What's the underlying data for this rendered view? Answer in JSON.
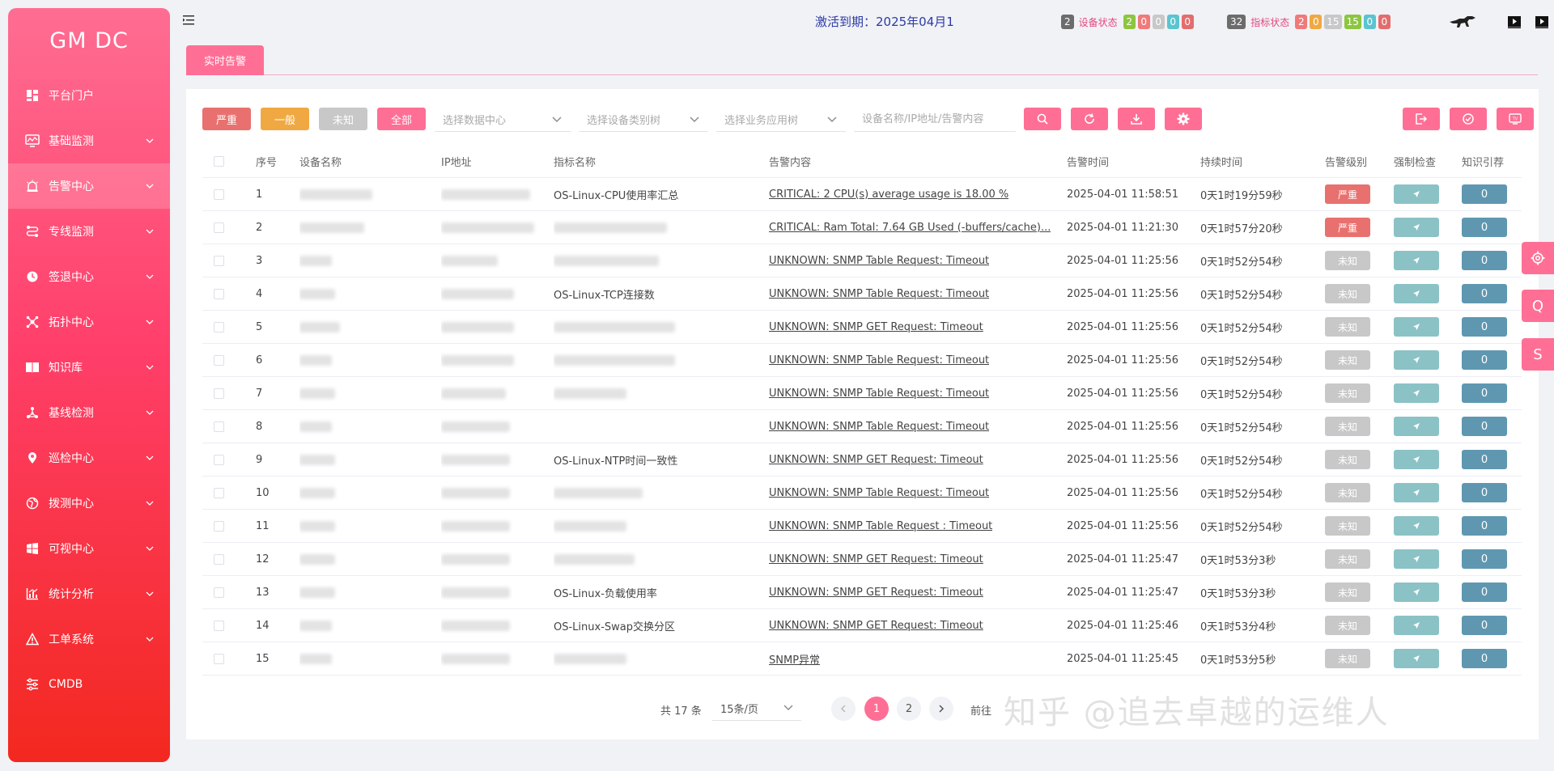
{
  "sidebar": {
    "brand": "GM DC",
    "items": [
      {
        "label": "平台门户",
        "icon": "dashboard-icon",
        "has_children": false,
        "active": false
      },
      {
        "label": "基础监测",
        "icon": "monitor-icon",
        "has_children": true,
        "active": false
      },
      {
        "label": "告警中心",
        "icon": "alarm-icon",
        "has_children": true,
        "active": true
      },
      {
        "label": "专线监测",
        "icon": "route-icon",
        "has_children": true,
        "active": false
      },
      {
        "label": "签退中心",
        "icon": "clock-icon",
        "has_children": true,
        "active": false
      },
      {
        "label": "拓扑中心",
        "icon": "topology-icon",
        "has_children": true,
        "active": false
      },
      {
        "label": "知识库",
        "icon": "book-icon",
        "has_children": true,
        "active": false
      },
      {
        "label": "基线检测",
        "icon": "network-icon",
        "has_children": true,
        "active": false
      },
      {
        "label": "巡检中心",
        "icon": "location-pin-icon",
        "has_children": true,
        "active": false
      },
      {
        "label": "拨测中心",
        "icon": "globe-icon",
        "has_children": true,
        "active": false
      },
      {
        "label": "可视中心",
        "icon": "windows-icon",
        "has_children": true,
        "active": false
      },
      {
        "label": "统计分析",
        "icon": "bar-chart-icon",
        "has_children": true,
        "active": false
      },
      {
        "label": "工单系统",
        "icon": "warning-icon",
        "has_children": true,
        "active": false
      },
      {
        "label": "CMDB",
        "icon": "sliders-icon",
        "has_children": false,
        "active": false
      }
    ]
  },
  "header": {
    "expire_text": "激活到期：2025年04月1",
    "device_status": {
      "count": "2",
      "title": "设备状态",
      "pills": [
        {
          "v": "2",
          "c": "#8cc63f"
        },
        {
          "v": "0",
          "c": "#f07a7a"
        },
        {
          "v": "0",
          "c": "#c8c8c8"
        },
        {
          "v": "0",
          "c": "#5bc4d0"
        },
        {
          "v": "0",
          "c": "#e36d6d"
        }
      ]
    },
    "metric_status": {
      "count": "32",
      "title": "指标状态",
      "pills": [
        {
          "v": "2",
          "c": "#f07a7a"
        },
        {
          "v": "0",
          "c": "#f0a942"
        },
        {
          "v": "15",
          "c": "#c8c8c8"
        },
        {
          "v": "15",
          "c": "#8cc63f"
        },
        {
          "v": "0",
          "c": "#5bc4d0"
        },
        {
          "v": "0",
          "c": "#e36d6d"
        }
      ]
    }
  },
  "tabs": [
    {
      "label": "实时告警"
    }
  ],
  "toolbar": {
    "btn_critical": "严重",
    "btn_normal": "一般",
    "btn_unknown": "未知",
    "btn_all": "全部",
    "select_dc": "选择数据中心",
    "select_device_type": "选择设备类别树",
    "select_app": "选择业务应用树",
    "search_placeholder": "设备名称/IP地址/告警内容"
  },
  "table": {
    "headers": [
      "序号",
      "设备名称",
      "IP地址",
      "指标名称",
      "告警内容",
      "告警时间",
      "持续时间",
      "告警级别",
      "强制检查",
      "知识引荐"
    ],
    "rows": [
      {
        "no": "1",
        "device": "",
        "ip": "",
        "metric": "OS-Linux-CPU使用率汇总",
        "content": "CRITICAL: 2 CPU(s) average usage is 18.00 %",
        "time": "2025-04-01 11:58:51",
        "duration": "0天1时19分59秒",
        "level": "严重",
        "kb": "0"
      },
      {
        "no": "2",
        "device": "",
        "ip": "",
        "metric": "",
        "content": "CRITICAL: Ram Total: 7.64 GB Used (-buffers/cache)...",
        "time": "2025-04-01 11:21:30",
        "duration": "0天1时57分20秒",
        "level": "严重",
        "kb": "0"
      },
      {
        "no": "3",
        "device": "",
        "ip": "",
        "metric": "",
        "content": "UNKNOWN: SNMP Table Request: Timeout",
        "time": "2025-04-01 11:25:56",
        "duration": "0天1时52分54秒",
        "level": "未知",
        "kb": "0"
      },
      {
        "no": "4",
        "device": "",
        "ip": "",
        "metric": "OS-Linux-TCP连接数",
        "content": "UNKNOWN: SNMP Table Request: Timeout",
        "time": "2025-04-01 11:25:56",
        "duration": "0天1时52分54秒",
        "level": "未知",
        "kb": "0"
      },
      {
        "no": "5",
        "device": "",
        "ip": "",
        "metric": "",
        "content": "UNKNOWN: SNMP GET Request: Timeout",
        "time": "2025-04-01 11:25:56",
        "duration": "0天1时52分54秒",
        "level": "未知",
        "kb": "0"
      },
      {
        "no": "6",
        "device": "",
        "ip": "",
        "metric": "",
        "content": "UNKNOWN: SNMP Table Request: Timeout",
        "time": "2025-04-01 11:25:56",
        "duration": "0天1时52分54秒",
        "level": "未知",
        "kb": "0"
      },
      {
        "no": "7",
        "device": "",
        "ip": "",
        "metric": "",
        "content": "UNKNOWN: SNMP Table Request: Timeout",
        "time": "2025-04-01 11:25:56",
        "duration": "0天1时52分54秒",
        "level": "未知",
        "kb": "0"
      },
      {
        "no": "8",
        "device": "",
        "ip": "",
        "metric": "",
        "content": "UNKNOWN: SNMP Table Request: Timeout",
        "time": "2025-04-01 11:25:56",
        "duration": "0天1时52分54秒",
        "level": "未知",
        "kb": "0"
      },
      {
        "no": "9",
        "device": "",
        "ip": "",
        "metric": "OS-Linux-NTP时间一致性",
        "content": "UNKNOWN: SNMP GET Request: Timeout",
        "time": "2025-04-01 11:25:56",
        "duration": "0天1时52分54秒",
        "level": "未知",
        "kb": "0"
      },
      {
        "no": "10",
        "device": "",
        "ip": "",
        "metric": "",
        "content": "UNKNOWN: SNMP Table Request: Timeout",
        "time": "2025-04-01 11:25:56",
        "duration": "0天1时52分54秒",
        "level": "未知",
        "kb": "0"
      },
      {
        "no": "11",
        "device": "",
        "ip": "",
        "metric": "",
        "content": "UNKNOWN: SNMP Table Request : Timeout",
        "time": "2025-04-01 11:25:56",
        "duration": "0天1时52分54秒",
        "level": "未知",
        "kb": "0"
      },
      {
        "no": "12",
        "device": "",
        "ip": "",
        "metric": "",
        "content": "UNKNOWN: SNMP GET Request: Timeout",
        "time": "2025-04-01 11:25:47",
        "duration": "0天1时53分3秒",
        "level": "未知",
        "kb": "0"
      },
      {
        "no": "13",
        "device": "",
        "ip": "",
        "metric": "OS-Linux-负载使用率",
        "content": "UNKNOWN: SNMP GET Request: Timeout",
        "time": "2025-04-01 11:25:47",
        "duration": "0天1时53分3秒",
        "level": "未知",
        "kb": "0"
      },
      {
        "no": "14",
        "device": "",
        "ip": "",
        "metric": "OS-Linux-Swap交换分区",
        "content": "UNKNOWN: SNMP GET Request: Timeout",
        "time": "2025-04-01 11:25:46",
        "duration": "0天1时53分4秒",
        "level": "未知",
        "kb": "0"
      },
      {
        "no": "15",
        "device": "",
        "ip": "",
        "metric": "",
        "content": "SNMP异常",
        "time": "2025-04-01 11:25:45",
        "duration": "0天1时53分5秒",
        "level": "未知",
        "kb": "0"
      }
    ]
  },
  "pagination": {
    "total": "共 17 条",
    "page_size": "15条/页",
    "pages": [
      "1",
      "2"
    ],
    "current": "1",
    "goto": "前往"
  },
  "floats": [
    "Q",
    "S"
  ],
  "watermark": "知乎 @追去卓越的运维人",
  "colors": {
    "accent": "#ff6f95",
    "critical": "#e8716f",
    "normal": "#f0a942",
    "unknown": "#c8c8c8",
    "all": "#ff6f95"
  }
}
